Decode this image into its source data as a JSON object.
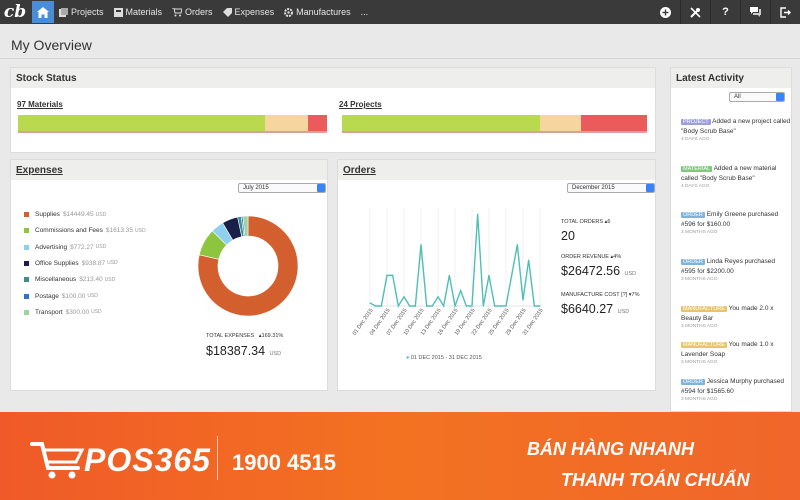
{
  "app": {
    "logo": "cb"
  },
  "nav": {
    "items": [
      {
        "label": "Projects"
      },
      {
        "label": "Materials"
      },
      {
        "label": "Orders"
      },
      {
        "label": "Expenses"
      },
      {
        "label": "Manufactures"
      },
      {
        "label": "..."
      }
    ],
    "right_icons": [
      "plus-icon",
      "tools-icon",
      "help-icon",
      "chat-icon",
      "logout-icon"
    ],
    "help_label": "?"
  },
  "page": {
    "title": "My Overview"
  },
  "stock": {
    "title": "Stock Status",
    "materials_label": "97 Materials",
    "projects_label": "24 Projects",
    "materials_bar": [
      0.8,
      0.14,
      0.06
    ],
    "projects_bar": [
      0.78,
      0.16,
      0.26
    ],
    "colors": {
      "good": "#b9d94f",
      "warn": "#f7d59f",
      "low": "#ec5b5b"
    }
  },
  "expenses": {
    "title": "Expenses",
    "period": "July 2015",
    "legend": [
      {
        "name": "Supplies",
        "value": "$14449.45",
        "unit": "USD",
        "color": "#d35f2e"
      },
      {
        "name": "Commissions and Fees",
        "value": "$1613.35",
        "unit": "USD",
        "color": "#8cc63f"
      },
      {
        "name": "Advertising",
        "value": "$772.27",
        "unit": "USD",
        "color": "#8fd0f0"
      },
      {
        "name": "Office Supplies",
        "value": "$938.87",
        "unit": "USD",
        "color": "#1a1f4a"
      },
      {
        "name": "Miscellaneous",
        "value": "$213.40",
        "unit": "USD",
        "color": "#3b8f8f"
      },
      {
        "name": "Postage",
        "value": "$100.00",
        "unit": "USD",
        "color": "#2c73d2"
      },
      {
        "name": "Transport",
        "value": "$300.00",
        "unit": "USD",
        "color": "#9fd39f"
      }
    ],
    "total_label": "TOTAL EXPENSES",
    "total_change": "169.31%",
    "total_value": "$18387.34",
    "total_unit": "USD"
  },
  "orders": {
    "title": "Orders",
    "period": "December 2015",
    "chart_data": {
      "type": "line",
      "x": [
        "01 Dec 2015",
        "02 Dec 2015",
        "03 Dec 2015",
        "04 Dec 2015",
        "05 Dec 2015",
        "06 Dec 2015",
        "07 Dec 2015",
        "08 Dec 2015",
        "09 Dec 2015",
        "10 Dec 2015",
        "11 Dec 2015",
        "12 Dec 2015",
        "13 Dec 2015",
        "14 Dec 2015",
        "15 Dec 2015",
        "16 Dec 2015",
        "17 Dec 2015",
        "18 Dec 2015",
        "19 Dec 2015",
        "20 Dec 2015",
        "21 Dec 2015",
        "22 Dec 2015",
        "23 Dec 2015",
        "24 Dec 2015",
        "25 Dec 2015",
        "26 Dec 2015",
        "27 Dec 2015",
        "28 Dec 2015",
        "29 Dec 2015",
        "30 Dec 2015",
        "31 Dec 2015"
      ],
      "tick_labels": [
        "01 Dec 2015",
        "04 Dec 2015",
        "07 Dec 2015",
        "10 Dec 2015",
        "13 Dec 2015",
        "16 Dec 2015",
        "19 Dec 2015",
        "22 Dec 2015",
        "25 Dec 2015",
        "28 Dec 2015",
        "31 Dec 2015"
      ],
      "values": [
        0.1,
        0,
        0,
        1,
        1,
        0,
        0.3,
        0,
        0,
        2,
        0,
        0,
        0.3,
        0,
        1,
        0,
        0.5,
        0,
        0,
        3,
        0,
        1,
        0,
        0,
        0,
        1,
        2,
        0.2,
        1.5,
        0,
        0
      ],
      "ylim": [
        0,
        3.2
      ],
      "grid": true,
      "color": "#4fbfb5",
      "legend": "01 DEC 2015 - 31 DEC 2015"
    },
    "stats": [
      {
        "label": "TOTAL ORDERS",
        "change": "6",
        "value": "20",
        "unit": ""
      },
      {
        "label": "ORDER REVENUE",
        "change": "4%",
        "value": "$26472.56",
        "unit": "USD"
      },
      {
        "label": "MANUFACTURE COST [?]",
        "change": "7%",
        "value": "$6640.27",
        "unit": "USD"
      }
    ]
  },
  "activity": {
    "title": "Latest Activity",
    "filter": "All",
    "items": [
      {
        "tag": "PROJECT",
        "color": "#9b9fe0",
        "text": "Added a new project called \"Body Scrub Base\"",
        "ago": "4 DAYS AGO"
      },
      {
        "tag": "MATERIAL",
        "color": "#7ec97e",
        "text": "Added a new material called \"Body Scrub Base\"",
        "ago": "4 DAYS AGO"
      },
      {
        "tag": "ORDER",
        "color": "#7fb3d9",
        "text": "Emily Greene purchased #596 for $160.00",
        "ago": "3 MONTHS AGO"
      },
      {
        "tag": "ORDER",
        "color": "#7fb3d9",
        "text": "Linda Reyes purchased #595 for $2200.00",
        "ago": "3 MONTHS AGO"
      },
      {
        "tag": "MANUFACTURE",
        "color": "#e8c46a",
        "text": "You made 2.0 x Beauty Bar",
        "ago": "3 MONTHS AGO"
      },
      {
        "tag": "MANUFACTURE",
        "color": "#e8c46a",
        "text": "You made 1.0 x Lavender Soap",
        "ago": "3 MONTHS AGO"
      },
      {
        "tag": "ORDER",
        "color": "#7fb3d9",
        "text": "Jessica Murphy purchased #594 for $1565.60",
        "ago": "3 MONTHS AGO"
      }
    ]
  },
  "banner": {
    "logo": "POS365",
    "phone": "1900 4515",
    "slogan_line1": "BÁN HÀNG NHANH",
    "slogan_line2": "THANH TOÁN CHUẨN"
  }
}
